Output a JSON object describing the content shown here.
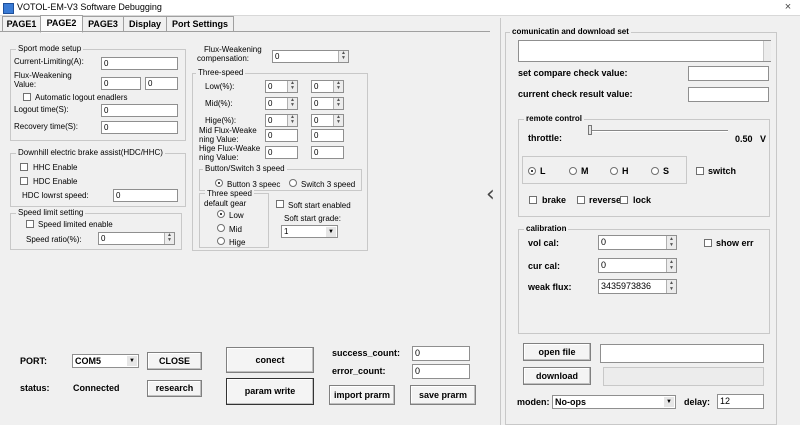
{
  "window": {
    "title": "VOTOL-EM-V3 Software Debugging",
    "close_glyph": "×"
  },
  "tabs": [
    "PAGE1",
    "PAGE2",
    "PAGE3",
    "Display",
    "Port Settings"
  ],
  "sport_mode": {
    "title": "Sport mode setup",
    "current_limit_label": "Current-Limiting(A):",
    "current_limit_value": "0",
    "flux_label_1": "Flux-Weakening",
    "flux_label_2": "Value:",
    "flux_value_1": "0",
    "flux_value_2": "0",
    "auto_logout_label": "Automatic logout enadlers",
    "logout_time_label": "Logout time(S):",
    "logout_time_value": "0",
    "recovery_time_label": "Recovery time(S):",
    "recovery_time_value": "0"
  },
  "hdc": {
    "title": "Downhill electric brake assist(HDC/HHC)",
    "hhc_label": "HHC Enable",
    "hdc_label": "HDC Enable",
    "lowest_speed_label": "HDC lowrst speed:",
    "lowest_speed_value": "0"
  },
  "speed_limit": {
    "title": "Speed limit setting",
    "enable_label": "Speed limited enable",
    "ratio_label": "Speed ratio(%):",
    "ratio_value": "0"
  },
  "flux_comp": {
    "label_1": "Flux-Weakening",
    "label_2": "compensation:",
    "value": "0"
  },
  "three_speed": {
    "title": "Three-speed",
    "low_label": "Low(%):",
    "mid_label": "Mid(%):",
    "hige_label": "Hige(%):",
    "values_a": [
      "0",
      "0",
      "0"
    ],
    "values_b": [
      "0",
      "0",
      "0"
    ],
    "mid_flux_1": "Mid Flux-Weake",
    "mid_flux_2": "ning Value:",
    "mid_flux_value": "0",
    "mid_flux_value_b": "0",
    "hige_flux_1": "Hige Flux-Weake",
    "hige_flux_2": "ning Value:",
    "hige_flux_value": "0",
    "hige_flux_value_b": "0"
  },
  "button_switch": {
    "title": "Button/Switch 3 speed",
    "button_label": "Button 3 speec",
    "switch_label": "Switch 3 speed"
  },
  "default_gear": {
    "title_1": "Three speed",
    "title_2": "default gear",
    "options": [
      "Low",
      "Mid",
      "Hige"
    ]
  },
  "soft_start": {
    "enable_label": "Soft start enabled",
    "grade_label": "Soft start grade:",
    "grade_value": "1"
  },
  "bottom": {
    "port_label": "PORT:",
    "port_value": "COM5",
    "close_label": "CLOSE",
    "status_label": "status:",
    "status_value": "Connected",
    "research_label": "research",
    "conect_label": "conect",
    "param_write_label": "param write",
    "success_label": "success_count:",
    "success_value": "0",
    "error_label": "error_count:",
    "error_value": "0",
    "import_label": "import prarm",
    "save_label": "save prarm"
  },
  "comm": {
    "title": "comunicatin and download set",
    "compare_label": "set compare check value:",
    "current_check_label": "current check result value:"
  },
  "remote": {
    "title": "remote control",
    "throttle_label": "throttle:",
    "throttle_value": "0.50",
    "throttle_unit": "V",
    "throttle_level": 0.0,
    "gears": [
      "L",
      "M",
      "H",
      "S"
    ],
    "switch_label": "switch",
    "brake_label": "brake",
    "reverse_label": "reverse",
    "lock_label": "lock"
  },
  "calibration": {
    "title": "calibration",
    "vol_label": "vol cal:",
    "vol_value": "0",
    "cur_label": "cur cal:",
    "cur_value": "0",
    "weak_label": "weak flux:",
    "weak_value": "3435973836",
    "show_err_label": "show err"
  },
  "file": {
    "open_label": "open file",
    "download_label": "download",
    "moden_label": "moden:",
    "moden_value": "No-ops",
    "delay_label": "delay:",
    "delay_value": "12"
  },
  "nav": {
    "collapse_glyph": "‹"
  }
}
